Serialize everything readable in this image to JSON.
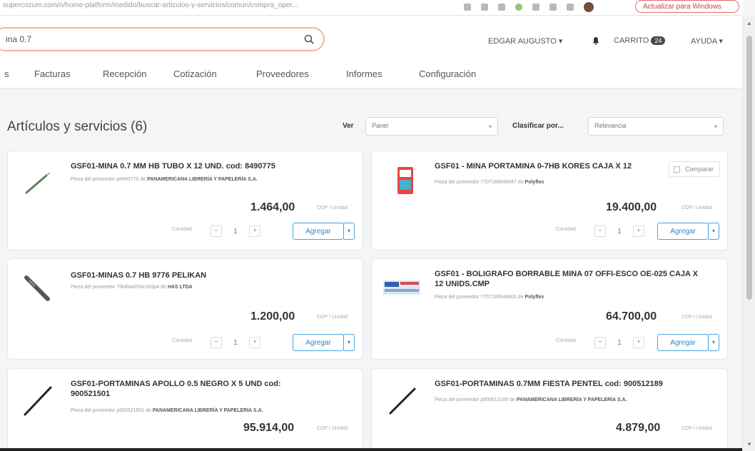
{
  "browser": {
    "url": "supercozum.com/n/home-platform/medido/buscar-articulos-y-servicios/comun/compra_oper...",
    "update_label": "Actualizar para Windows"
  },
  "header": {
    "search_value": "ina 0.7",
    "user": "EDGAR AUGUSTO ▾",
    "cart_label": "CARRITO",
    "cart_count": "24",
    "help": "AYUDA ▾"
  },
  "nav": {
    "tabs": [
      {
        "label": "s"
      },
      {
        "label": "Facturas"
      },
      {
        "label": "Recepción"
      },
      {
        "label": "Cotización"
      },
      {
        "label": "Proveedores"
      },
      {
        "label": "Informes"
      },
      {
        "label": "Configuración"
      }
    ]
  },
  "results": {
    "title": "Artículos y servicios (6)",
    "view_label": "Ver",
    "view_value": "Panel",
    "sort_label": "Clasificar por...",
    "sort_value": "Relevancia"
  },
  "common": {
    "qty_label": "Cantidad",
    "add_label": "Agregar",
    "unit_label": "COP / Unidad",
    "compare_label": "Comparar",
    "supplier_prefix": "Pieza del proveedor",
    "supplier_of": "de"
  },
  "products": [
    {
      "name": "GSF01-MINA 0.7 MM HB TUBO X 12 UND. cod: 8490775",
      "supplier_code": "p8490775",
      "supplier": "PANAMERICANA LIBRERÍA Y PAPELERÍA S.A.",
      "price": "1.464,00",
      "qty": "1"
    },
    {
      "name": "GSF01 - MINA PORTAMINA 0-7HB KORES CAJA X 12",
      "supplier_code": "7707189044047",
      "supplier": "Polyflex",
      "price": "19.400,00",
      "qty": "1"
    },
    {
      "name": "GSF01-MINAS 0.7 HB 9776 PELIKAN",
      "supplier_code": "7f4d0a4224c163p4",
      "supplier": "HAS LTDA",
      "price": "1.200,00",
      "qty": "1"
    },
    {
      "name": "GSF01 - BOLIGRAFO BORRABLE MINA 07 OFFI-ESCO OE-025 CAJA X 12 UNIDS.CMP",
      "supplier_code": "7707189044603",
      "supplier": "Polyflex",
      "price": "64.700,00",
      "qty": "1"
    },
    {
      "name": "GSF01-PORTAMINAS APOLLO 0.5 NEGRO X 5 UND cod: 900521501",
      "supplier_code": "p900521501",
      "supplier": "PANAMERICANA LIBRERÍA Y PAPELERÍA S.A.",
      "price": "95.914,00",
      "qty": "1"
    },
    {
      "name": "GSF01-PORTAMINAS 0.7MM FIESTA PENTEL cod: 900512189",
      "supplier_code": "p900512189",
      "supplier": "PANAMERICANA LIBRERÍA Y PAPELERÍA S.A.",
      "price": "4.879,00",
      "qty": "1"
    }
  ],
  "colors": {
    "accent": "#2f86c7",
    "search_border": "#f2b3a0"
  }
}
